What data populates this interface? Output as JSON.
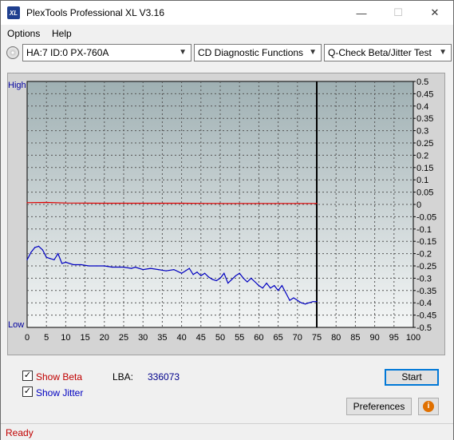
{
  "window": {
    "title": "PlexTools Professional XL V3.16",
    "app_icon_text": "XL",
    "minimize_glyph": "—",
    "maximize_glyph": "☐",
    "close_glyph": "✕"
  },
  "menu": {
    "options": "Options",
    "help": "Help"
  },
  "toolbar": {
    "drive": "HA:7 ID:0  PX-760A",
    "function": "CD Diagnostic Functions",
    "test": "Q-Check Beta/Jitter Test",
    "arrow": "▼"
  },
  "chart_data": {
    "type": "line",
    "left_axis": {
      "top_label": "High",
      "bottom_label": "Low"
    },
    "right_axis": {
      "ylim": [
        -0.5,
        0.5
      ],
      "tick_labels": [
        "0.5",
        "0.45",
        "0.4",
        "0.35",
        "0.3",
        "0.25",
        "0.2",
        "0.15",
        "0.1",
        "0.05",
        "0",
        "-0.05",
        "-0.1",
        "-0.15",
        "-0.2",
        "-0.25",
        "-0.3",
        "-0.35",
        "-0.4",
        "-0.45",
        "-0.5"
      ]
    },
    "x_axis": {
      "xlim": [
        0,
        100
      ],
      "tick_labels": [
        "0",
        "5",
        "10",
        "15",
        "20",
        "25",
        "30",
        "35",
        "40",
        "45",
        "50",
        "55",
        "60",
        "65",
        "70",
        "75",
        "80",
        "85",
        "90",
        "95",
        "100"
      ]
    },
    "cursor_x": 75,
    "series": [
      {
        "color": "#e00000",
        "x": [
          0,
          5,
          10,
          20,
          30,
          40,
          50,
          60,
          70,
          75
        ],
        "y": [
          0.007,
          0.008,
          0.006,
          0.005,
          0.005,
          0.005,
          0.004,
          0.004,
          0.004,
          0.004
        ]
      },
      {
        "color": "#0000c0",
        "x": [
          0,
          1,
          2,
          3,
          4,
          5,
          6,
          7,
          8,
          9,
          10,
          12,
          14,
          16,
          18,
          20,
          22,
          24,
          25,
          27,
          28,
          30,
          32,
          34,
          36,
          38,
          40,
          41,
          42,
          43,
          44,
          45,
          46,
          47,
          48,
          49,
          50,
          51,
          52,
          53,
          54,
          55,
          56,
          57,
          58,
          59,
          60,
          61,
          62,
          63,
          64,
          65,
          66,
          67,
          68,
          69,
          70,
          71,
          72,
          73,
          74,
          75
        ],
        "y": [
          -0.225,
          -0.195,
          -0.175,
          -0.17,
          -0.185,
          -0.215,
          -0.22,
          -0.225,
          -0.2,
          -0.24,
          -0.235,
          -0.245,
          -0.245,
          -0.25,
          -0.25,
          -0.25,
          -0.255,
          -0.255,
          -0.255,
          -0.26,
          -0.255,
          -0.265,
          -0.26,
          -0.265,
          -0.27,
          -0.265,
          -0.28,
          -0.27,
          -0.26,
          -0.285,
          -0.275,
          -0.29,
          -0.28,
          -0.295,
          -0.305,
          -0.31,
          -0.3,
          -0.28,
          -0.32,
          -0.305,
          -0.29,
          -0.28,
          -0.3,
          -0.315,
          -0.3,
          -0.315,
          -0.33,
          -0.34,
          -0.32,
          -0.34,
          -0.33,
          -0.35,
          -0.33,
          -0.36,
          -0.39,
          -0.38,
          -0.39,
          -0.4,
          -0.405,
          -0.4,
          -0.395,
          -0.395
        ]
      }
    ],
    "grid": true
  },
  "controls": {
    "show_beta_label": "Show Beta",
    "show_beta_checked": true,
    "show_jitter_label": "Show Jitter",
    "show_jitter_checked": true,
    "lba_label": "LBA:",
    "lba_value": "336073",
    "start_label": "Start",
    "preferences_label": "Preferences",
    "checkmark": "✓",
    "info_glyph": "i"
  },
  "status": {
    "text": "Ready"
  }
}
